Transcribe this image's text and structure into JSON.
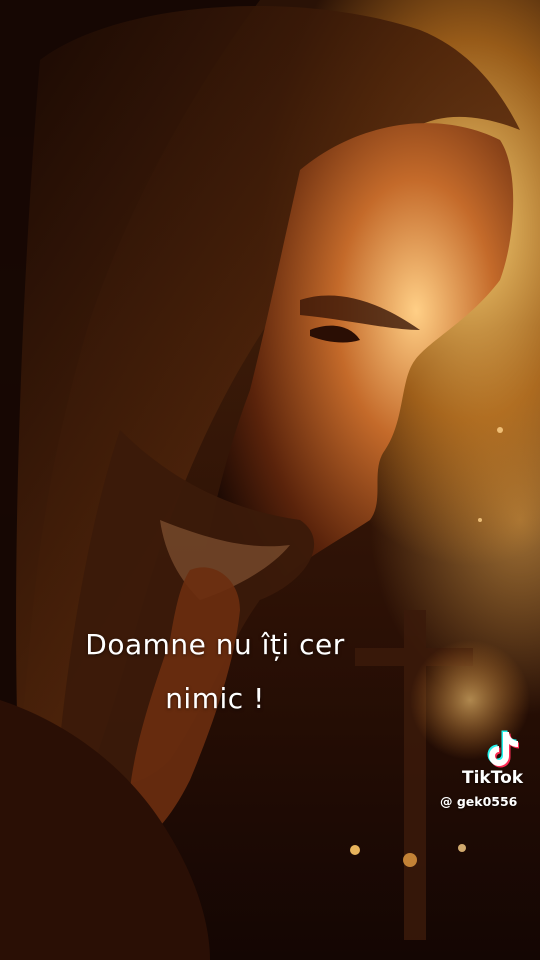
{
  "overlay": {
    "caption_lines": [
      "Doamne nu îți cer",
      "nimic !"
    ]
  },
  "watermark": {
    "brand": "TikTok",
    "username": "@ gek0556",
    "icon": "tiktok-logo-icon"
  },
  "colors": {
    "caption_text": "#ffffff",
    "glow": "#ffc766",
    "shadow": "#120703"
  }
}
